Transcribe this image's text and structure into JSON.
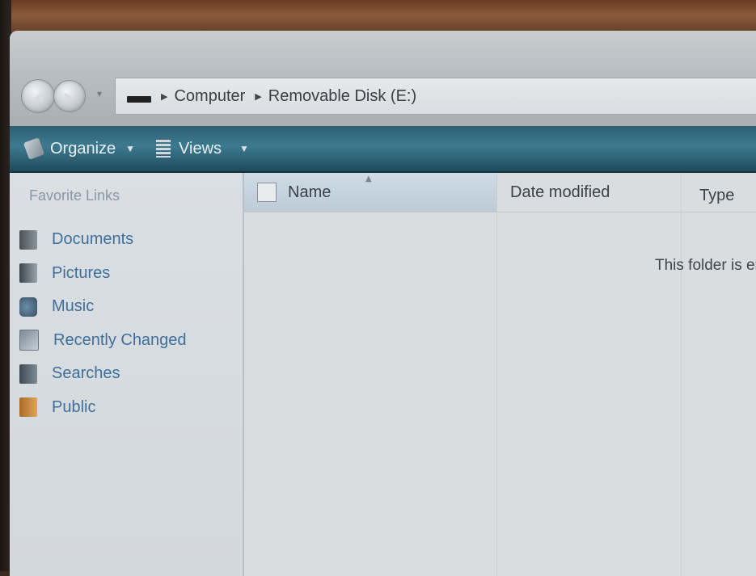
{
  "address_bar": {
    "breadcrumbs": [
      "Computer",
      "Removable Disk (E:)"
    ]
  },
  "toolbar": {
    "organize_label": "Organize",
    "views_label": "Views"
  },
  "left_pane": {
    "title": "Favorite Links",
    "items": [
      {
        "label": "Documents",
        "icon": "documents-icon"
      },
      {
        "label": "Pictures",
        "icon": "pictures-icon"
      },
      {
        "label": "Music",
        "icon": "music-icon"
      },
      {
        "label": "Recently Changed",
        "icon": "recently-changed-icon"
      },
      {
        "label": "Searches",
        "icon": "searches-icon"
      },
      {
        "label": "Public",
        "icon": "public-folder-icon"
      }
    ]
  },
  "file_list": {
    "columns": [
      "Name",
      "Date modified",
      "Type"
    ],
    "empty_message": "This folder is empty."
  },
  "colors": {
    "toolbar": "#2e5f72",
    "link_text": "#3f6f9a",
    "pane_background": "#dadfe4"
  }
}
